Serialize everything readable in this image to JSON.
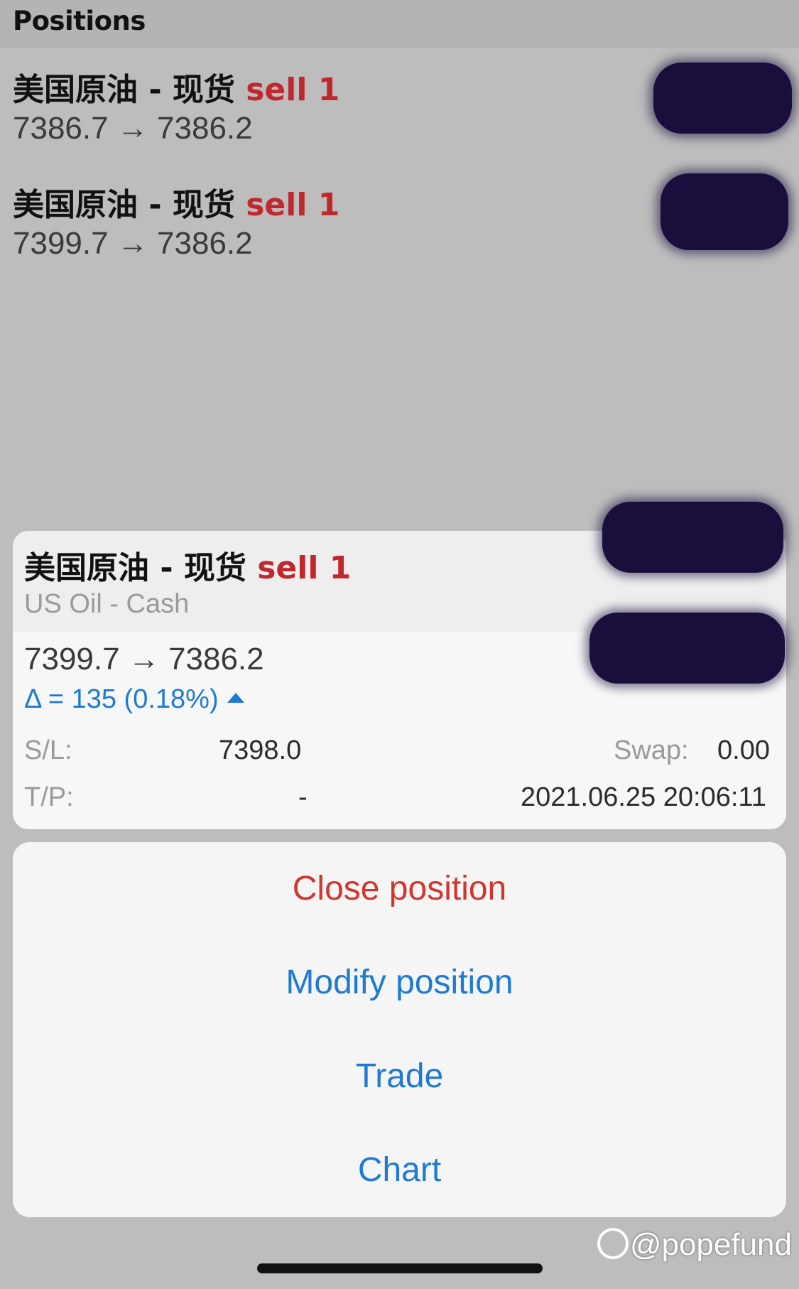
{
  "header": {
    "title": "Positions"
  },
  "positions": [
    {
      "symbol": "美国原油 - 现货",
      "type": "sell 1",
      "prices": "7386.7 → 7386.2"
    },
    {
      "symbol": "美国原油 - 现货",
      "type": "sell 1",
      "prices": "7399.7 → 7386.2"
    }
  ],
  "detail": {
    "symbol": "美国原油 - 现货",
    "type": "sell 1",
    "description": "US Oil - Cash",
    "prices": "7399.7 → 7386.2",
    "delta": "Δ = 135 (0.18%)",
    "sl_label": "S/L:",
    "sl_value": "7398.0",
    "swap_label": "Swap:",
    "swap_value": "0.00",
    "tp_label": "T/P:",
    "tp_value": "-",
    "timestamp": "2021.06.25 20:06:11"
  },
  "actions": {
    "close": "Close position",
    "modify": "Modify position",
    "trade": "Trade",
    "chart": "Chart"
  },
  "watermark": "@popefund",
  "colors": {
    "sell": "#c0282d",
    "accent": "#1f7ad1",
    "destructive": "#d0362f"
  }
}
